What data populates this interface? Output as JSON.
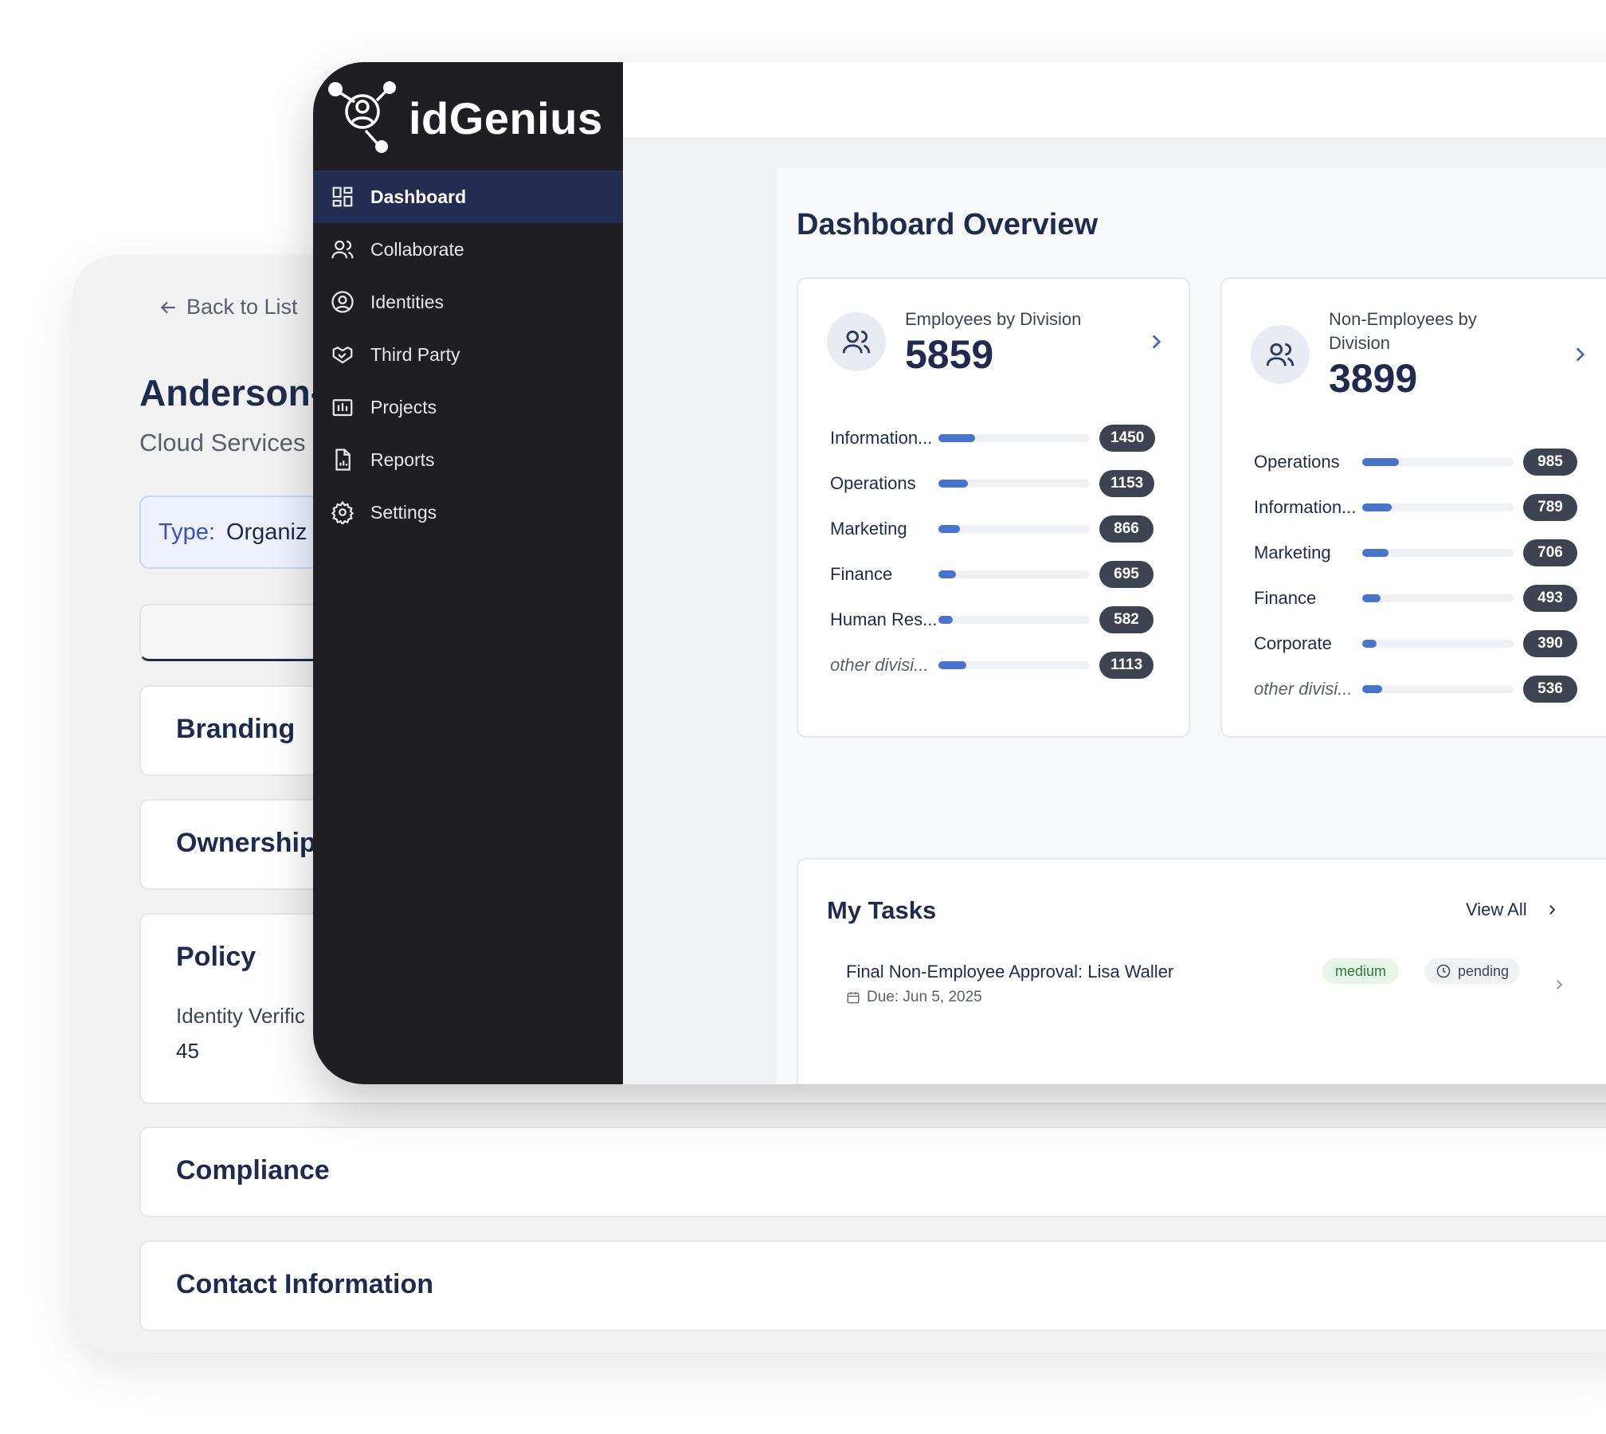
{
  "org": {
    "back_label": "Back to List",
    "title": "Anderson-",
    "subtitle": "Cloud Services",
    "type_label": "Type:",
    "type_value": "Organiz",
    "sections": {
      "branding": "Branding",
      "ownership": "Ownership",
      "policy": "Policy",
      "policy_field_label": "Identity Verific",
      "policy_field_value": "45",
      "compliance": "Compliance",
      "contact": "Contact Information"
    }
  },
  "app": {
    "brand": "idGenius",
    "nav": [
      {
        "label": "Dashboard",
        "icon": "grid-icon",
        "active": true
      },
      {
        "label": "Collaborate",
        "icon": "users-icon"
      },
      {
        "label": "Identities",
        "icon": "user-circle-icon"
      },
      {
        "label": "Third Party",
        "icon": "handshake-icon"
      },
      {
        "label": "Projects",
        "icon": "chart-folder-icon"
      },
      {
        "label": "Reports",
        "icon": "report-file-icon"
      },
      {
        "label": "Settings",
        "icon": "gear-icon"
      }
    ]
  },
  "dashboard": {
    "title": "Dashboard Overview",
    "employees": {
      "label": "Employees by Division",
      "total": "5859",
      "rows": [
        {
          "name": "Information...",
          "value": 1450
        },
        {
          "name": "Operations",
          "value": 1153
        },
        {
          "name": "Marketing",
          "value": 866
        },
        {
          "name": "Finance",
          "value": 695
        },
        {
          "name": "Human Res...",
          "value": 582
        },
        {
          "name": "other divisi...",
          "value": 1113,
          "italic": true
        }
      ]
    },
    "non_employees": {
      "label_line1": "Non-Employees by",
      "label_line2": "Division",
      "total": "3899",
      "rows": [
        {
          "name": "Operations",
          "value": 985
        },
        {
          "name": "Information...",
          "value": 789
        },
        {
          "name": "Marketing",
          "value": 706
        },
        {
          "name": "Finance",
          "value": 493
        },
        {
          "name": "Corporate",
          "value": 390
        },
        {
          "name": "other divisi...",
          "value": 536,
          "italic": true
        }
      ]
    },
    "tasks": {
      "title": "My Tasks",
      "view_all": "View All",
      "items": [
        {
          "title": "Final Non-Employee Approval: Lisa Waller",
          "due": "Due: Jun 5, 2025",
          "priority": "medium",
          "status": "pending"
        }
      ]
    }
  },
  "colors": {
    "sidebar": "#1f1f23",
    "active_nav": "#222d4f",
    "bar": "#4a72cf",
    "pill": "#3d4350"
  }
}
